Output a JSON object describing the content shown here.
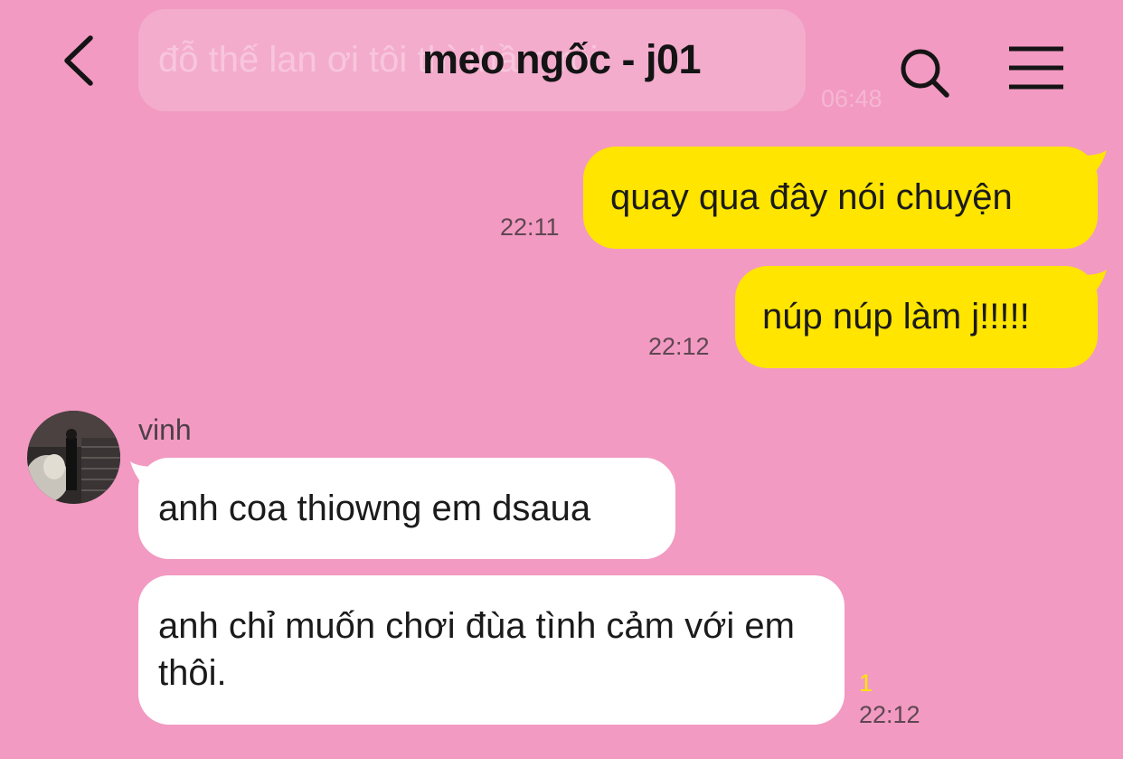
{
  "header": {
    "title": "meo ngốc - j01",
    "back_icon": "chevron-left-icon",
    "search_icon": "search-icon",
    "menu_icon": "menu-icon"
  },
  "faded_message": {
    "text": "đỗ thế lan ơi tôi thì thầm rồi",
    "time": "06:48"
  },
  "messages_out": [
    {
      "text": "quay qua đây nói chuyện",
      "time": "22:11"
    },
    {
      "text": "núp núp làm j!!!!!",
      "time": "22:12"
    }
  ],
  "contact": {
    "name": "vinh"
  },
  "messages_in": [
    {
      "text": "anh coa thiowng em dsaua"
    },
    {
      "text": "anh chỉ muốn chơi đùa tình cảm với em thôi.",
      "unread": "1",
      "time": "22:12"
    }
  ],
  "colors": {
    "background": "#f29ac2",
    "outgoing_bubble": "#ffe500",
    "incoming_bubble": "#ffffff"
  }
}
